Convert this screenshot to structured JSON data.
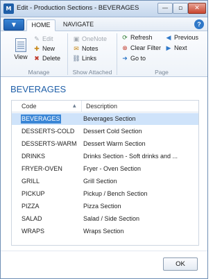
{
  "window": {
    "title": "Edit - Production Sections - BEVERAGES",
    "minimize_glyph": "—",
    "maximize_glyph": "▫",
    "close_glyph": "✕"
  },
  "tabs": {
    "menu_glyph": "▼",
    "home": "HOME",
    "navigate": "NAVIGATE",
    "help_glyph": "?"
  },
  "ribbon": {
    "manage": {
      "label": "Manage",
      "view": "View",
      "edit": "Edit",
      "new": "New",
      "delete": "Delete"
    },
    "show_attached": {
      "label": "Show Attached",
      "onenote": "OneNote",
      "notes": "Notes",
      "links": "Links"
    },
    "page": {
      "label": "Page",
      "refresh": "Refresh",
      "clear_filter": "Clear Filter",
      "go_to": "Go to",
      "previous": "Previous",
      "next": "Next"
    }
  },
  "icons": {
    "edit": "✎",
    "new": "✚",
    "delete": "✖",
    "onenote": "▣",
    "notes": "✉",
    "links": "⛓",
    "refresh": "⟳",
    "clear_filter": "⊗",
    "go_to": "➜",
    "previous": "◀",
    "next": "▶",
    "sort": "▲"
  },
  "colors": {
    "accent": "#1f5fa8",
    "selection": "#cfe3fa",
    "selected_cell": "#3a86d6",
    "delete_icon": "#c0392b",
    "go_icon": "#2e7d32"
  },
  "page": {
    "title": "BEVERAGES"
  },
  "grid": {
    "columns": [
      "Code",
      "Description"
    ],
    "rows": [
      {
        "code": "BEVERAGES",
        "description": "Beverages Section",
        "selected": true
      },
      {
        "code": "DESSERTS-COLD",
        "description": "Dessert Cold Section"
      },
      {
        "code": "DESSERTS-WARM",
        "description": "Dessert Warm Section"
      },
      {
        "code": "DRINKS",
        "description": "Drinks Section - Soft drinks and ..."
      },
      {
        "code": "FRYER-OVEN",
        "description": "Fryer - Oven Section"
      },
      {
        "code": "GRILL",
        "description": "Grill Section"
      },
      {
        "code": "PICKUP",
        "description": "Pickup / Bench Section"
      },
      {
        "code": "PIZZA",
        "description": "Pizza Section"
      },
      {
        "code": "SALAD",
        "description": "Salad / Side Section"
      },
      {
        "code": "WRAPS",
        "description": "Wraps Section"
      }
    ]
  },
  "footer": {
    "ok": "OK"
  }
}
